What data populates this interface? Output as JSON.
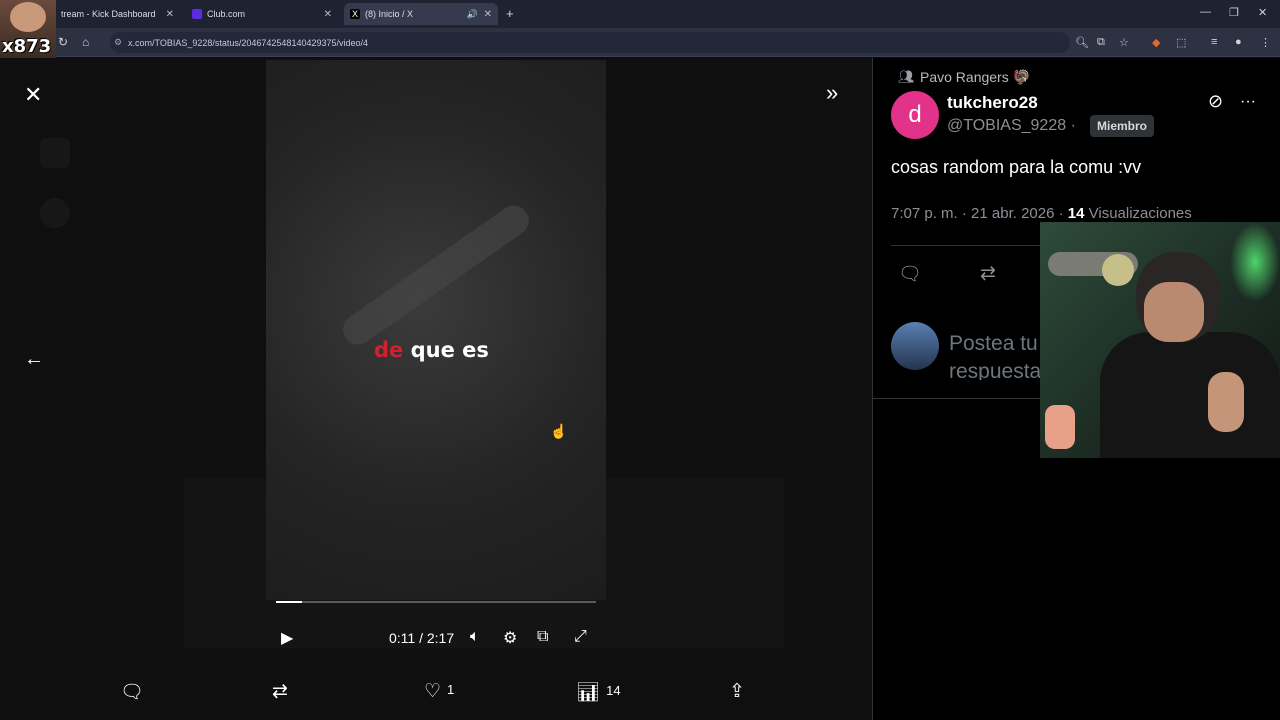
{
  "browser": {
    "tabs": [
      {
        "label": "tream - Kick Dashboard",
        "color": "#53fc18"
      },
      {
        "label": "Club.com",
        "color": "#5b2de0"
      },
      {
        "label": "(8) Inicio / X",
        "color": "#ffffff"
      }
    ],
    "url": "x.com/TOBIAS_9228/status/2046742548140429375/video/4"
  },
  "streamer_tag": "x873",
  "video": {
    "caption_red": "de",
    "caption_white": "que es",
    "time": "0:11 / 2:17",
    "progress": 0.08
  },
  "actions": {
    "likes": "1",
    "views": "14"
  },
  "post": {
    "community": "Pavo Rangers 🦃",
    "avatar_letter": "d",
    "username": "tukchero28",
    "handle": "@TOBIAS_9228 ·",
    "badge": "Miembro",
    "text": "cosas random para la comu :vv",
    "timestamp": "7:07 p. m. · 21 abr. 2026 ·",
    "views_count": "14",
    "views_label": "Visualizaciones",
    "reply_placeholder": "Postea tu respuesta"
  },
  "colors": {
    "accent": "#e23289",
    "caption_red": "#d4202a"
  }
}
